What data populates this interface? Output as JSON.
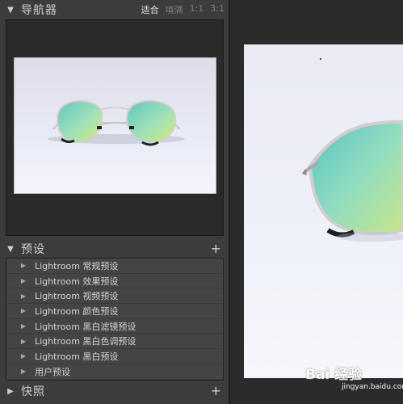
{
  "navigator": {
    "title": "导航器",
    "zoom_options": [
      "适合",
      "填满",
      "1:1",
      "3:1"
    ],
    "active_zoom": "适合"
  },
  "presets": {
    "title": "预设",
    "add_label": "+",
    "items": [
      "Lightroom 常规预设",
      "Lightroom 效果预设",
      "Lightroom 视频预设",
      "Lightroom 颜色预设",
      "Lightroom 黑白滤镜预设",
      "Lightroom 黑白色调预设",
      "Lightroom 黑白预设",
      "用户预设"
    ]
  },
  "snapshots": {
    "title": "快照",
    "add_label": "+"
  },
  "watermark": {
    "brand": "Bai 经验",
    "url": "jingyan.baidu.com"
  },
  "colors": {
    "panel_bg": "#3c3c3c",
    "list_bg": "#444444",
    "lens_tint": "#7fd9c6",
    "frame": "#c8c8c8"
  }
}
